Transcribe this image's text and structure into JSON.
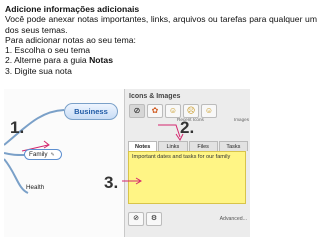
{
  "instructions": {
    "heading": "Adicione informações adicionais",
    "paragraph": "Você pode anexar notas importantes, links, arquivos ou tarefas para qualquer um dos seus temas.",
    "intro": "Para adicionar notas ao seu tema:",
    "step1": "1. Escolha o seu tema",
    "step2_prefix": "2. Alterne para a guia ",
    "step2_bold": "Notas",
    "step3": "3. Digite sua nota"
  },
  "mindmap": {
    "nodes": {
      "business": "Business",
      "family": "Family",
      "health": "Health"
    },
    "step_markers": {
      "one": "1.",
      "two": "2.",
      "three": "3."
    }
  },
  "panel": {
    "title": "Icons & Images",
    "icons": [
      "⊘",
      "✿",
      "☺",
      "☹",
      "☺"
    ],
    "icon_labels": {
      "recent": "Recent Icons",
      "images": "Images"
    },
    "tabs": [
      "Notes",
      "Links",
      "Files",
      "Tasks"
    ],
    "active_tab": "Notes",
    "note_text": "Important dates and tasks for our family",
    "bottom": {
      "advanced": "Advanced..."
    }
  },
  "colors": {
    "note_bg": "#fff585",
    "arrow": "#d4266e",
    "link": "#5d8fd0"
  }
}
